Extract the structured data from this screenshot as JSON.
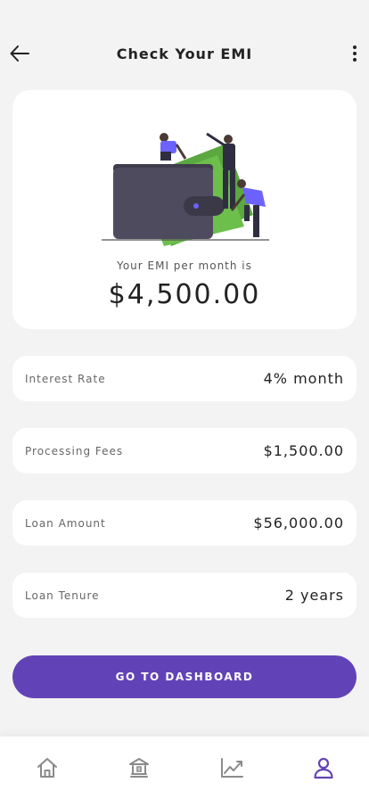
{
  "header": {
    "title": "Check Your EMI"
  },
  "summary": {
    "label": "Your EMI per month is",
    "value": "$4,500.00"
  },
  "details": [
    {
      "label": "Interest Rate",
      "value": "4% month"
    },
    {
      "label": "Processing Fees",
      "value": "$1,500.00"
    },
    {
      "label": "Loan Amount",
      "value": "$56,000.00"
    },
    {
      "label": "Loan Tenure",
      "value": "2 years"
    }
  ],
  "cta": {
    "label": "GO TO DASHBOARD"
  },
  "nav": {
    "items": [
      {
        "icon": "home-icon",
        "active": false
      },
      {
        "icon": "bank-icon",
        "active": false
      },
      {
        "icon": "chart-line-icon",
        "active": false
      },
      {
        "icon": "user-icon",
        "active": true
      }
    ]
  },
  "colors": {
    "accent": "#6243b7",
    "nav_inactive": "#8a8a8a",
    "money_green": "#6dbf4b",
    "wallet": "#4f4b5f"
  }
}
